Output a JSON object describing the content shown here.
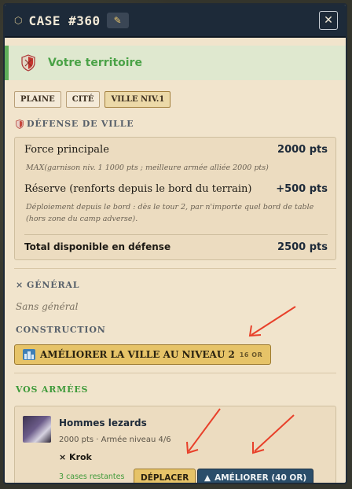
{
  "header": {
    "title": "CASE #360"
  },
  "territory": {
    "label": "Votre territoire"
  },
  "tags": [
    {
      "label": "PLAINE"
    },
    {
      "label": "CITÉ"
    },
    {
      "label": "VILLE NIV.1"
    }
  ],
  "defense": {
    "title": "DÉFENSE DE VILLE",
    "main_label": "Force principale",
    "main_value": "2000 pts",
    "main_note": "MAX(garnison niv. 1 1000 pts ; meilleure armée alliée 2000 pts)",
    "reserve_label": "Réserve (renforts depuis le bord du terrain)",
    "reserve_value": "+500 pts",
    "reserve_note": "Déploiement depuis le bord : dès le tour 2, par n'importe quel bord de table (hors zone du camp adverse).",
    "total_label": "Total disponible en défense",
    "total_value": "2500 pts"
  },
  "general": {
    "title": "GÉNÉRAL",
    "empty": "Sans général"
  },
  "construction": {
    "title": "CONSTRUCTION",
    "upgrade_label": "AMÉLIORER LA VILLE AU NIVEAU 2",
    "upgrade_cost": "16 OR"
  },
  "armies": {
    "title": "VOS ARMÉES",
    "items": [
      {
        "name": "Hommes lezards",
        "meta": "2000 pts · Armée niveau 4/6",
        "general": "Krok",
        "remaining": "3 cases restantes",
        "move_label": "DÉPLACER",
        "upgrade_label": "AMÉLIORER (40 OR)"
      }
    ]
  },
  "colors": {
    "header_bg": "#1d2a39",
    "panel_bg": "#f1e4cc",
    "gold_button": "#e6c368",
    "blue_button": "#2b4e6a",
    "green_text": "#4aa247",
    "annotation_arrow": "#e8402a"
  }
}
